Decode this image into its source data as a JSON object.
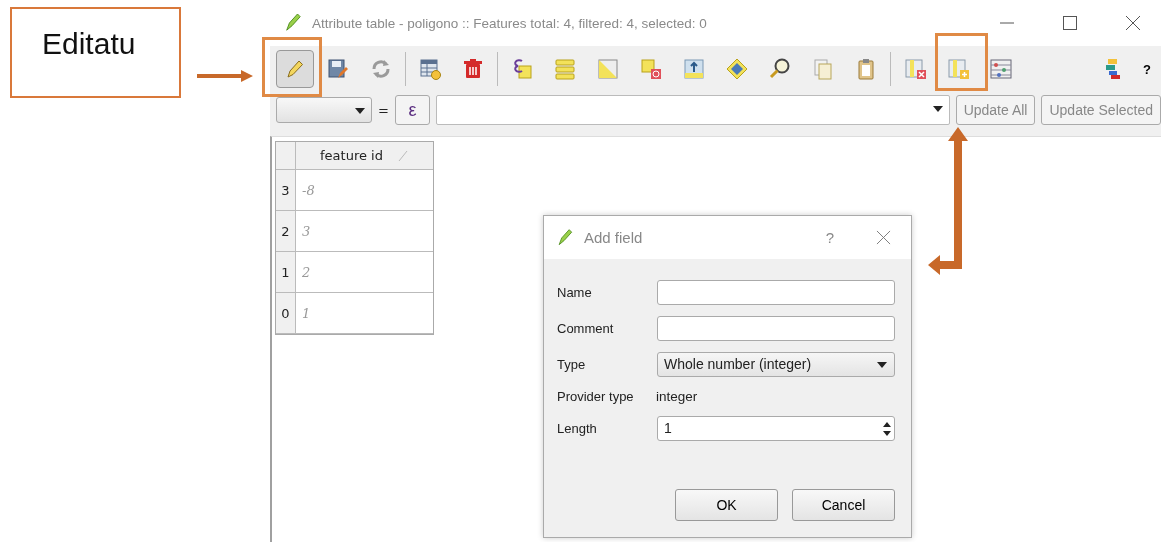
{
  "annotation": {
    "label": "Editatu"
  },
  "window": {
    "title": "Attribute table - poligono :: Features total: 4, filtered: 4, selected: 0"
  },
  "toolbar": [
    {
      "kind": "edit",
      "on": true
    },
    {
      "kind": "save",
      "on": false
    },
    {
      "kind": "reload",
      "on": false
    },
    {
      "kind": "separator"
    },
    {
      "kind": "new-feature",
      "on": false
    },
    {
      "kind": "delete",
      "on": false
    },
    {
      "kind": "separator"
    },
    {
      "kind": "select-expression",
      "on": false
    },
    {
      "kind": "select-all",
      "on": false
    },
    {
      "kind": "invert",
      "on": false
    },
    {
      "kind": "deselect",
      "on": false
    },
    {
      "kind": "move-top",
      "on": false
    },
    {
      "kind": "pan",
      "on": false
    },
    {
      "kind": "zoom",
      "on": false
    },
    {
      "kind": "copy",
      "on": false
    },
    {
      "kind": "paste",
      "on": false
    },
    {
      "kind": "separator"
    },
    {
      "kind": "delete-field",
      "on": false
    },
    {
      "kind": "add-field",
      "on": false
    },
    {
      "kind": "calculator",
      "on": false
    },
    {
      "kind": "spacer"
    },
    {
      "kind": "dock",
      "on": false
    },
    {
      "kind": "help",
      "on": false,
      "label": "?"
    }
  ],
  "filter_bar": {
    "operator": "=",
    "expression_button": "ε",
    "buttons": [
      "Update All",
      "Update Selected"
    ]
  },
  "table": {
    "columns": [
      "feature id"
    ],
    "rows": [
      {
        "row_header": "3",
        "cells": [
          "-8"
        ]
      },
      {
        "row_header": "2",
        "cells": [
          "3"
        ]
      },
      {
        "row_header": "1",
        "cells": [
          "2"
        ]
      },
      {
        "row_header": "0",
        "cells": [
          "1"
        ]
      }
    ]
  },
  "dialog": {
    "title": "Add field",
    "help": "?",
    "fields": [
      {
        "kind": "text",
        "label": "Name"
      },
      {
        "kind": "text",
        "label": "Comment"
      },
      {
        "kind": "combo",
        "label": "Type",
        "value": "Whole number (integer)"
      },
      {
        "kind": "info",
        "label": "Provider type",
        "value": "integer"
      },
      {
        "kind": "spin",
        "label": "Length",
        "value": "1"
      }
    ],
    "buttons": [
      "OK",
      "Cancel"
    ]
  }
}
